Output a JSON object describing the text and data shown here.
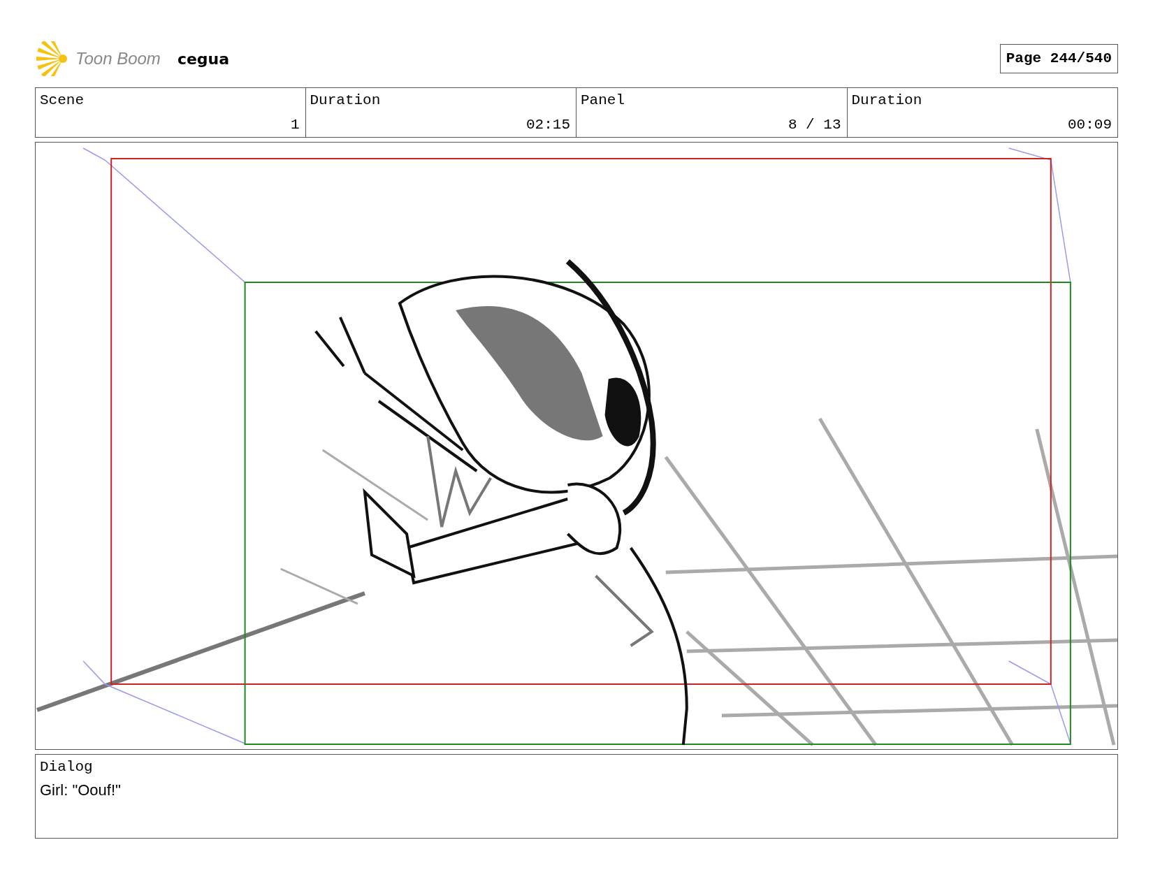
{
  "header": {
    "brand": "Toon Boom",
    "project": "cegua",
    "page": "Page 244/540"
  },
  "info_table": {
    "columns": [
      "Scene",
      "Duration",
      "Panel",
      "Duration"
    ],
    "row": [
      "1",
      "02:15",
      "8 / 13",
      "00:09"
    ]
  },
  "dialog": {
    "label": "Dialog",
    "text": "Girl: \"Oouf!\""
  }
}
